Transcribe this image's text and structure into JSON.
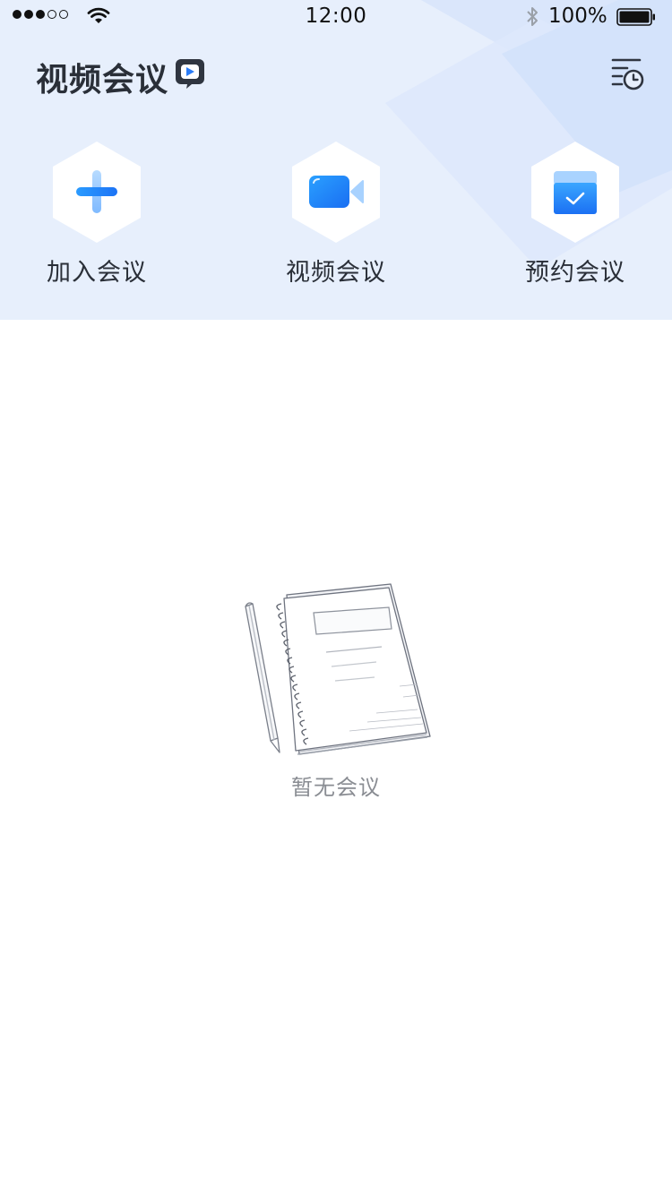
{
  "status_bar": {
    "time": "12:00",
    "battery": "100%",
    "signal_bars_filled": 3,
    "signal_bars_total": 5
  },
  "nav": {
    "title": "视频会议",
    "logo_icon": "chat-play-icon",
    "history_icon": "list-clock-icon"
  },
  "actions": [
    {
      "label": "加入会议",
      "icon": "plus-icon"
    },
    {
      "label": "视频会议",
      "icon": "video-camera-icon"
    },
    {
      "label": "预约会议",
      "icon": "calendar-check-icon"
    }
  ],
  "empty_state": {
    "text": "暂无会议",
    "illustration": "notebook-pencil-sketch"
  },
  "colors": {
    "header_bg": "#e7effc",
    "accent": "#1f86ff",
    "accent_light": "#9fcbff",
    "title_text": "#2a2f38",
    "muted_text": "#8a8d93"
  }
}
